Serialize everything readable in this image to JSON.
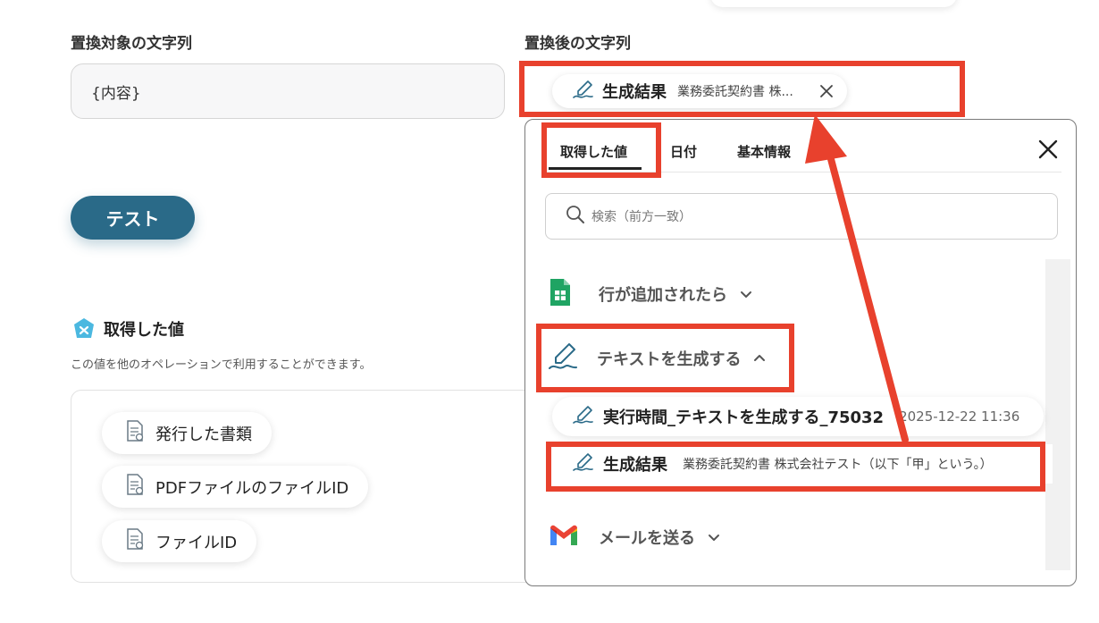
{
  "form": {
    "source_label": "置換対象の文字列",
    "source_value": "{内容}",
    "target_label": "置換後の文字列",
    "test_button": "テスト"
  },
  "selected_chip": {
    "label": "生成結果",
    "value": "業務委託契約書 株..."
  },
  "obtained_values": {
    "title": "取得した値",
    "description": "この値を他のオペレーションで利用することができます。",
    "items": [
      {
        "label": "発行した書類",
        "icon": "document-icon"
      },
      {
        "label": "PDFファイルのファイルID",
        "icon": "document-icon"
      },
      {
        "label": "ファイルID",
        "icon": "document-icon"
      }
    ]
  },
  "panel": {
    "tabs": [
      "取得した値",
      "日付",
      "基本情報"
    ],
    "active_tab": "取得した値",
    "search_placeholder": "検索（前方一致）",
    "sections": [
      {
        "label": "行が追加されたら",
        "icon": "google-sheets-icon",
        "expanded": false
      },
      {
        "label": "テキストを生成する",
        "icon": "ai-pen-icon",
        "expanded": true,
        "items": [
          {
            "label": "実行時間_テキストを生成する_75032",
            "value": "2025-12-22 11:36"
          },
          {
            "label": "生成結果",
            "value": "業務委託契約書 株式会社テスト（以下「甲」という。）"
          }
        ]
      },
      {
        "label": "メールを送る",
        "icon": "gmail-icon",
        "expanded": false
      }
    ]
  },
  "colors": {
    "accent": "#2a6a88",
    "highlight": "#e8412d"
  }
}
